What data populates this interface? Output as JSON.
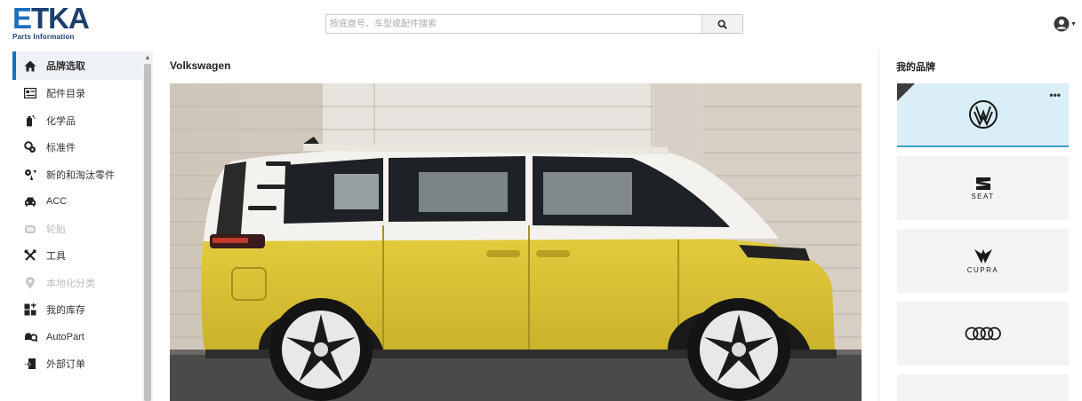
{
  "header": {
    "logo_title": "ETKA",
    "logo_subtitle": "Parts Information",
    "search_placeholder": "按底盘号、车型或配件搜索"
  },
  "sidebar": {
    "items": [
      {
        "label": "品牌选取",
        "icon": "home-icon",
        "active": true,
        "disabled": false
      },
      {
        "label": "配件目录",
        "icon": "catalog-icon",
        "active": false,
        "disabled": false
      },
      {
        "label": "化学品",
        "icon": "chemicals-icon",
        "active": false,
        "disabled": false
      },
      {
        "label": "标准件",
        "icon": "standard-parts-icon",
        "active": false,
        "disabled": false
      },
      {
        "label": "新的和淘汰零件",
        "icon": "new-obsolete-parts-icon",
        "active": false,
        "disabled": false
      },
      {
        "label": "ACC",
        "icon": "car-icon",
        "active": false,
        "disabled": false
      },
      {
        "label": "轮胎",
        "icon": "tire-icon",
        "active": false,
        "disabled": true
      },
      {
        "label": "工具",
        "icon": "tools-icon",
        "active": false,
        "disabled": false
      },
      {
        "label": "本地化分类",
        "icon": "location-pin-icon",
        "active": false,
        "disabled": true
      },
      {
        "label": "我的库存",
        "icon": "inventory-icon",
        "active": false,
        "disabled": false
      },
      {
        "label": "AutoPart",
        "icon": "autopart-icon",
        "active": false,
        "disabled": false
      },
      {
        "label": "外部订单",
        "icon": "external-order-icon",
        "active": false,
        "disabled": false
      }
    ]
  },
  "main": {
    "brand_title": "Volkswagen",
    "hero_image": "vehicle-photo-icon"
  },
  "right_panel": {
    "title": "我的品牌",
    "card_menu": "•••",
    "brands": [
      {
        "name": "Volkswagen",
        "icon": "volkswagen-logo-icon",
        "label": "",
        "selected": true
      },
      {
        "name": "SEAT",
        "icon": "seat-logo-icon",
        "label": "SEAT",
        "selected": false
      },
      {
        "name": "CUPRA",
        "icon": "cupra-logo-icon",
        "label": "CUPRA",
        "selected": false
      },
      {
        "name": "Audi",
        "icon": "audi-logo-icon",
        "label": "",
        "selected": false
      },
      {
        "name": "",
        "icon": "",
        "label": "",
        "selected": false
      }
    ]
  },
  "colors": {
    "accent": "#1e6dc0",
    "logo_navy": "#1c3f6e",
    "selected_card": "#d9eef6",
    "van_yellow": "#d8c234",
    "van_white": "#f4f2ee"
  }
}
